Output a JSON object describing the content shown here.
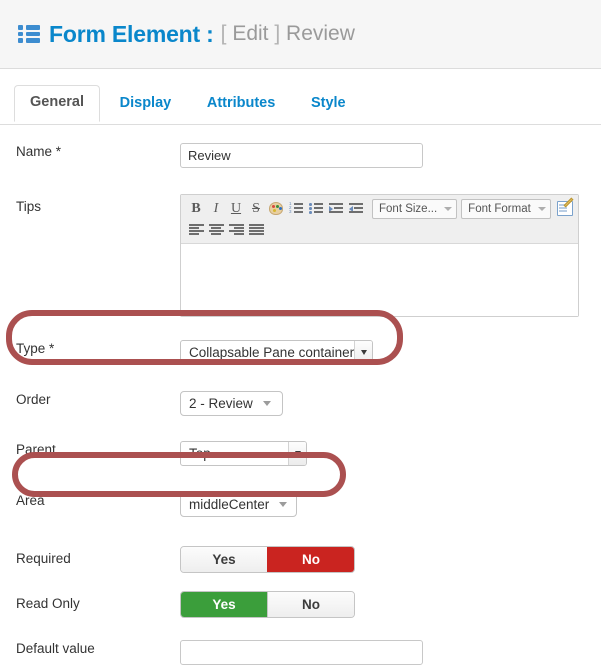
{
  "header": {
    "icon": "list-grid-icon",
    "title": "Form Element :",
    "edit_bracket_open": "[",
    "edit_label": "Edit",
    "edit_bracket_close": "]",
    "record_name": "Review",
    "title_color": "#0a87cb",
    "icon_color": "#3d8dd0"
  },
  "tabs": [
    {
      "label": "General",
      "active": true
    },
    {
      "label": "Display",
      "active": false
    },
    {
      "label": "Attributes",
      "active": false
    },
    {
      "label": "Style",
      "active": false
    }
  ],
  "form": {
    "name": {
      "label": "Name *",
      "value": "Review",
      "placeholder": ""
    },
    "tips": {
      "label": "Tips",
      "value": "",
      "editor": {
        "buttons": [
          {
            "name": "bold-icon",
            "glyph": "B"
          },
          {
            "name": "italic-icon",
            "glyph": "I"
          },
          {
            "name": "underline-icon",
            "glyph": "U"
          },
          {
            "name": "strikethrough-icon",
            "glyph": "S"
          },
          {
            "name": "text-color-palette-icon",
            "glyph": ""
          },
          {
            "name": "numbered-list-icon",
            "glyph": ""
          },
          {
            "name": "bulleted-list-icon",
            "glyph": ""
          },
          {
            "name": "increase-indent-icon",
            "glyph": ""
          },
          {
            "name": "decrease-indent-icon",
            "glyph": ""
          },
          {
            "name": "align-left-icon",
            "glyph": ""
          },
          {
            "name": "align-center-icon",
            "glyph": ""
          },
          {
            "name": "align-right-icon",
            "glyph": ""
          },
          {
            "name": "justify-icon",
            "glyph": ""
          },
          {
            "name": "edit-source-icon",
            "glyph": ""
          }
        ],
        "font_size_label": "Font Size...",
        "font_format_label": "Font Format"
      }
    },
    "type": {
      "label": "Type *",
      "value": "Collapsable Pane container",
      "highlighted": true
    },
    "order": {
      "label": "Order",
      "value": "2 - Review"
    },
    "parent": {
      "label": "Parent",
      "value": "Top"
    },
    "area": {
      "label": "Area",
      "value": "middleCenter",
      "highlighted": true
    },
    "required": {
      "label": "Required",
      "yes_label": "Yes",
      "no_label": "No",
      "selected": "No",
      "active_color": "#ca2420"
    },
    "read_only": {
      "label": "Read Only",
      "yes_label": "Yes",
      "no_label": "No",
      "selected": "Yes",
      "active_color": "#3b9e3b"
    },
    "default_value": {
      "label": "Default value",
      "value": "",
      "placeholder": ""
    }
  },
  "annotations": {
    "highlight_color": "#ab5050",
    "rings": [
      "type-row",
      "area-row"
    ]
  }
}
